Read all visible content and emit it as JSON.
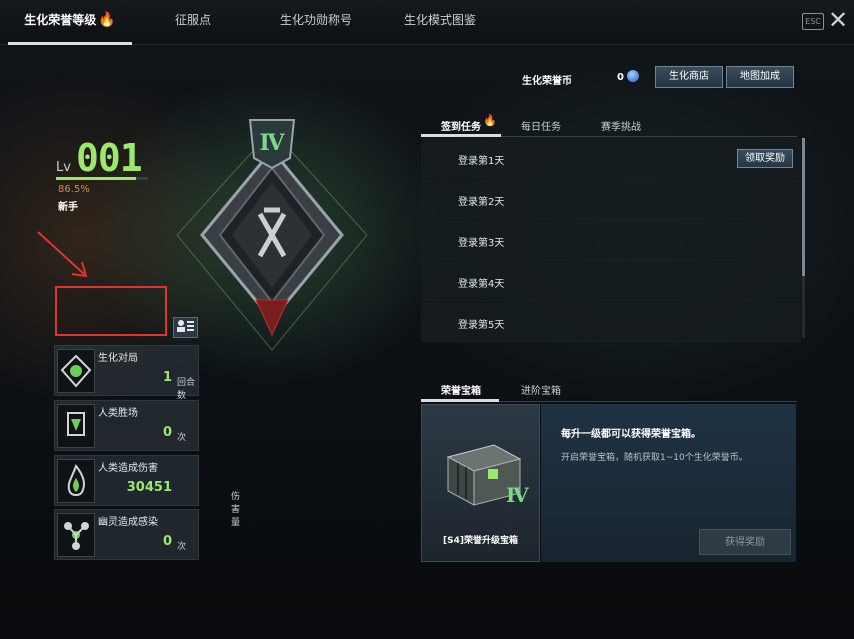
{
  "top_tabs": [
    {
      "label": "生化荣誉等级",
      "active": true,
      "badge": "hot"
    },
    {
      "label": "征服点",
      "active": false
    },
    {
      "label": "生化功勋称号",
      "active": false
    },
    {
      "label": "生化模式图鉴",
      "active": false
    }
  ],
  "window": {
    "esc_label": "ESC",
    "close_icon": "close-icon"
  },
  "level": {
    "prefix": "Lv",
    "number": "001",
    "progress_text": "86.5%",
    "progress": 0.865,
    "rank": "新手"
  },
  "badge": {
    "roman": "Ⅳ"
  },
  "stats": [
    {
      "label": "生化对局",
      "value": "1",
      "unit": "回合数",
      "icon": "biohazard-emblem-icon"
    },
    {
      "label": "人类胜场",
      "value": "0",
      "unit": "次",
      "icon": "victory-flag-icon"
    },
    {
      "label": "人类造成伤害",
      "value": "30451",
      "unit": "伤害量",
      "icon": "flame-icon"
    },
    {
      "label": "幽灵造成感染",
      "value": "0",
      "unit": "次",
      "icon": "infection-icon"
    }
  ],
  "currency": {
    "label": "生化荣誉币",
    "value": "0",
    "icon": "gem-coin-icon"
  },
  "header_buttons": {
    "shop": "生化商店",
    "map_bonus": "地图加成"
  },
  "mission_tabs": [
    {
      "label": "签到任务",
      "active": true,
      "badge": "hot"
    },
    {
      "label": "每日任务",
      "active": false
    },
    {
      "label": "赛季挑战",
      "active": false
    }
  ],
  "checkin_rows": [
    {
      "label": "登录第1天",
      "action": "领取奖励"
    },
    {
      "label": "登录第2天"
    },
    {
      "label": "登录第3天"
    },
    {
      "label": "登录第4天"
    },
    {
      "label": "登录第5天"
    }
  ],
  "chest_tabs": [
    {
      "label": "荣誉宝箱",
      "active": true
    },
    {
      "label": "进阶宝箱",
      "active": false
    }
  ],
  "chest": {
    "name": "[S4]荣誉升级宝箱",
    "roman": "Ⅳ",
    "title": "每升一级都可以获得荣誉宝箱。",
    "desc": "开启荣誉宝箱，随机获取1~10个生化荣誉币。",
    "claim_label": "获得奖励"
  },
  "colors": {
    "accent_green": "#9be86b",
    "progress_orange": "#d18a5b",
    "highlight_red": "#e0322f"
  }
}
